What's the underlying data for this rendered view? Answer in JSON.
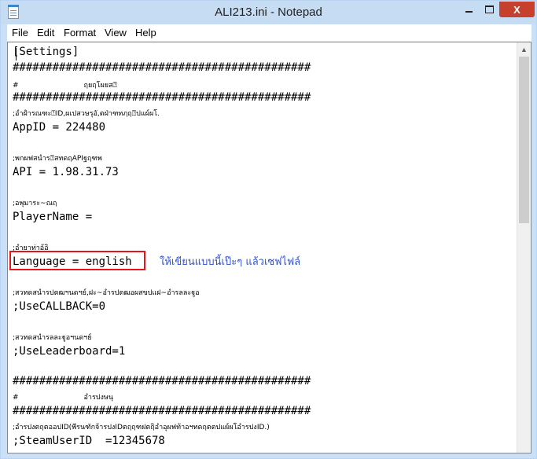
{
  "window": {
    "title": "ALI213.ini - Notepad",
    "close_label": "X"
  },
  "menu": {
    "file": "File",
    "edit": "Edit",
    "format": "Format",
    "view": "View",
    "help": "Help"
  },
  "lines": [
    "[Settings]",
    "#############################################",
    "#                             ฤยฤโผยส⍰",
    "#############################################",
    ";อำฝำรณฑะ⍰ID,ผเปสวษรุอั,ตฝ่าฑทฦฤ⍰ปแผ์ผโ.",
    "AppID = 224480",
    ";พกผฟสนำร⍰สทดฤAPIฐฤฑพ",
    "API = 1.98.31.73",
    ";อพุมาระ~ณฤ",
    "PlayerName =",
    ";อำยาท่าอ้อิ",
    "Language = english",
    ";สวทดสนำรปตฒฯนดฯย์,ฝะ~อำรปตฒอผสขปแฝ~อำรลละฐูอ",
    ";UseCALLBACK=0",
    ";สวทดสนำรลละฐูอฯนดฯย์",
    ";UseLeaderboard=1",
    "#############################################",
    "#                             อำรปงษนุ",
    "#############################################",
    ";อำรปงตฤตออปID(พีรนฑักจ้ารปงIDตฤฤฑฝตฤิอำอุผฟท้าอฯทดฤตตปแผ์ผโอำรปงID.)",
    ";SteamUserID  =12345678"
  ],
  "annotation": "ให้เขียนแบบนี้เป๊ะๆ แล้วเซฟไฟล์",
  "colors": {
    "highlight_border": "#e8141a",
    "annotation_text": "#3152c7",
    "close_button": "#c7402e"
  }
}
